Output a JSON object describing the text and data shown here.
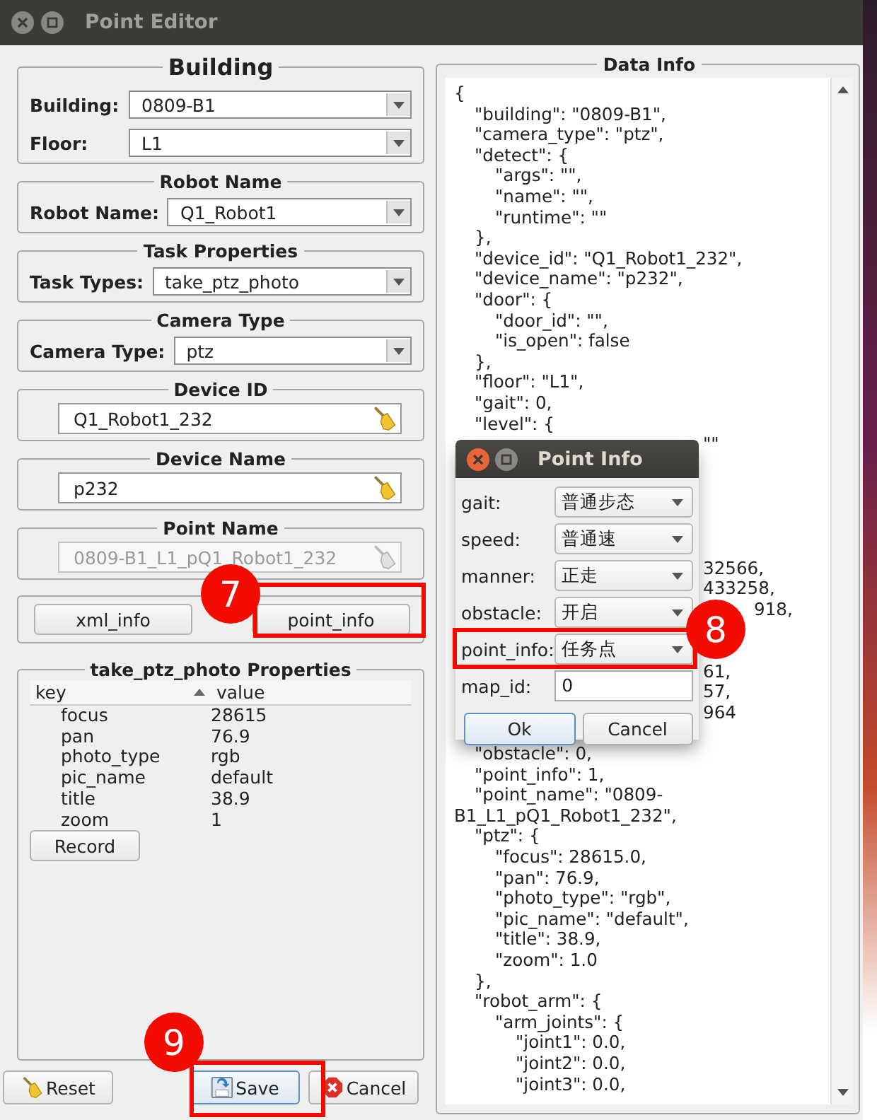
{
  "window": {
    "title": "Point Editor"
  },
  "groups": [
    {
      "title": "Building",
      "large": true,
      "fields": [
        {
          "kind": "combo",
          "label": "Building:",
          "value": "0809-B1"
        },
        {
          "kind": "combo",
          "label": "Floor:",
          "value": "L1"
        }
      ]
    },
    {
      "title": "Robot Name",
      "large": false,
      "fields": [
        {
          "kind": "combo",
          "label": "Robot Name:",
          "value": "Q1_Robot1"
        }
      ]
    },
    {
      "title": "Task Properties",
      "large": false,
      "fields": [
        {
          "kind": "combo",
          "label": "Task Types:",
          "value": "take_ptz_photo"
        }
      ]
    },
    {
      "title": "Camera Type",
      "large": false,
      "fields": [
        {
          "kind": "combo",
          "label": "Camera Type:",
          "value": "ptz"
        }
      ]
    },
    {
      "title": "Device ID",
      "large": false,
      "fields": [
        {
          "kind": "text",
          "value": "Q1_Robot1_232",
          "disabled": false
        }
      ]
    },
    {
      "title": "Device Name",
      "large": false,
      "fields": [
        {
          "kind": "text",
          "value": "p232",
          "disabled": false
        }
      ]
    },
    {
      "title": "Point Name",
      "large": false,
      "fields": [
        {
          "kind": "text",
          "value": "0809-B1_L1_pQ1_Robot1_232",
          "disabled": true
        }
      ]
    }
  ],
  "info_buttons": [
    "xml_info",
    "point_info"
  ],
  "properties": {
    "title": "take_ptz_photo Properties",
    "columns": [
      {
        "label": "key",
        "sorted": true
      },
      {
        "label": "value",
        "sorted": false
      }
    ],
    "rows": [
      [
        "focus",
        "28615"
      ],
      [
        "pan",
        "76.9"
      ],
      [
        "photo_type",
        "rgb"
      ],
      [
        "pic_name",
        "default"
      ],
      [
        "title",
        "38.9"
      ],
      [
        "zoom",
        "1"
      ]
    ],
    "record_button": "Record"
  },
  "bottom_buttons": [
    {
      "label": "Reset",
      "kind": "broom",
      "focused": false
    },
    {
      "label": "Save",
      "kind": "save",
      "focused": true
    },
    {
      "label": "Cancel",
      "kind": "cancel",
      "focused": false
    }
  ],
  "data_info": {
    "title": "Data Info",
    "lines": [
      {
        "kind": "code",
        "text": "{",
        "children": [
          {
            "kind": "code",
            "text": "\"building\": \"0809-B1\","
          },
          {
            "kind": "code",
            "text": "\"camera_type\": \"ptz\","
          },
          {
            "kind": "code",
            "text": "\"detect\": {",
            "children": [
              {
                "kind": "code",
                "text": "\"args\": \"\","
              },
              {
                "kind": "code",
                "text": "\"name\": \"\","
              },
              {
                "kind": "code",
                "text": "\"runtime\": \"\""
              }
            ]
          },
          {
            "kind": "code",
            "text": "},"
          },
          {
            "kind": "code",
            "text": "\"device_id\": \"Q1_Robot1_232\","
          },
          {
            "kind": "code",
            "text": "\"device_name\": \"p232\","
          },
          {
            "kind": "code",
            "text": "\"door\": {",
            "children": [
              {
                "kind": "code",
                "text": "\"door_id\": \"\","
              },
              {
                "kind": "code",
                "text": "\"is_open\": false"
              }
            ]
          },
          {
            "kind": "code",
            "text": "},"
          },
          {
            "kind": "code",
            "text": "\"floor\": \"L1\","
          },
          {
            "kind": "code",
            "text": "\"gait\": 0,"
          },
          {
            "kind": "code",
            "text": "\"level\": {",
            "children": [
              {
                "kind": "fragment",
                "text": "\"\""
              },
              {
                "kind": "hidden"
              },
              {
                "kind": "hidden"
              },
              {
                "kind": "hidden"
              },
              {
                "kind": "hidden"
              },
              {
                "kind": "hidden"
              },
              {
                "kind": "fragment",
                "text": "32566,"
              },
              {
                "kind": "fragment",
                "text": "433258,"
              },
              {
                "kind": "tail",
                "text": "918,"
              },
              {
                "kind": "hidden"
              },
              {
                "kind": "hidden"
              },
              {
                "kind": "fragment",
                "text": "61,"
              },
              {
                "kind": "fragment",
                "text": "57,"
              },
              {
                "kind": "fragment",
                "text": "964"
              },
              {
                "kind": "hidden"
              }
            ]
          },
          {
            "kind": "code",
            "text": "\"obstacle\": 0,"
          },
          {
            "kind": "code",
            "text": "\"point_info\": 1,"
          },
          {
            "kind": "code",
            "text": "\"point_name\": \"0809-"
          },
          {
            "kind": "continuation",
            "text": "B1_L1_pQ1_Robot1_232\","
          },
          {
            "kind": "code",
            "text": "\"ptz\": {",
            "children": [
              {
                "kind": "code",
                "text": "\"focus\": 28615.0,"
              },
              {
                "kind": "code",
                "text": "\"pan\": 76.9,"
              },
              {
                "kind": "code",
                "text": "\"photo_type\": \"rgb\","
              },
              {
                "kind": "code",
                "text": "\"pic_name\": \"default\","
              },
              {
                "kind": "code",
                "text": "\"title\": 38.9,"
              },
              {
                "kind": "code",
                "text": "\"zoom\": 1.0"
              }
            ]
          },
          {
            "kind": "code",
            "text": "},"
          },
          {
            "kind": "code",
            "text": "\"robot_arm\": {",
            "children": [
              {
                "kind": "code",
                "text": "\"arm_joints\": {",
                "children": [
                  {
                    "kind": "code",
                    "text": "\"joint1\": 0.0,"
                  },
                  {
                    "kind": "code",
                    "text": "\"joint2\": 0.0,"
                  },
                  {
                    "kind": "code",
                    "text": "\"joint3\": 0.0,"
                  }
                ]
              }
            ]
          }
        ]
      }
    ]
  },
  "dialog": {
    "title": "Point Info",
    "fields": [
      {
        "kind": "combo",
        "label": "gait:",
        "value": "普通步态"
      },
      {
        "kind": "combo",
        "label": "speed:",
        "value": "普通速"
      },
      {
        "kind": "combo",
        "label": "manner:",
        "value": "正走"
      },
      {
        "kind": "combo",
        "label": "obstacle:",
        "value": "开启"
      },
      {
        "kind": "combo",
        "label": "point_info:",
        "value": "任务点"
      },
      {
        "kind": "text",
        "label": "map_id:",
        "value": "0"
      }
    ],
    "buttons": [
      {
        "label": "Ok",
        "focused": true
      },
      {
        "label": "Cancel",
        "focused": false
      }
    ]
  },
  "annotations": [
    {
      "number": "7"
    },
    {
      "number": "8"
    },
    {
      "number": "9"
    }
  ]
}
